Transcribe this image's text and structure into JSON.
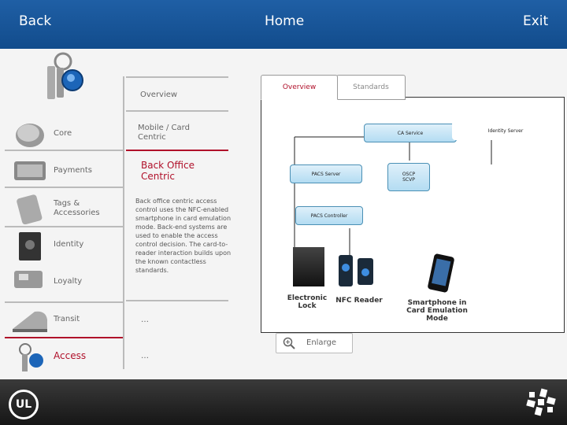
{
  "header": {
    "back_label": "Back",
    "home_label": "Home",
    "exit_label": "Exit"
  },
  "footer": {
    "left_logo_text": "UL"
  },
  "nav": {
    "items": [
      {
        "label": "Core"
      },
      {
        "label": "Payments"
      },
      {
        "label": "Tags & Accessories"
      },
      {
        "label": "Identity"
      },
      {
        "label": "Loyalty"
      },
      {
        "label": "Transit"
      },
      {
        "label": "Access"
      }
    ]
  },
  "submenu": {
    "overview": "Overview",
    "mobile_card": "Mobile / Card Centric",
    "back_office": "Back Office Centric",
    "description": "Back office centric access control uses the NFC-enabled smartphone in card emulation mode. Back-end systems are used to enable the access control decision. The card-to-reader interaction builds upon the known contactless standards.",
    "ellipsis_1": "…",
    "ellipsis_2": "…"
  },
  "diagram": {
    "tab_overview": "Overview",
    "tab_standards": "Standards",
    "ca_service": "CA Service",
    "identity_server": "Identity Server",
    "pacs_server": "PACS Server",
    "ocsp_line1": "OSCP",
    "ocsp_line2": "SCVP",
    "pacs_controller": "PACS Controller",
    "electronic_lock": "Electronic Lock",
    "nfc_reader": "NFC Reader",
    "smartphone": "Smartphone in Card Emulation Mode",
    "enlarge_label": "Enlarge"
  },
  "colors": {
    "header_blue": "#1a5599",
    "accent_red": "#b0102a",
    "box_blue": "#b3dcf2"
  }
}
